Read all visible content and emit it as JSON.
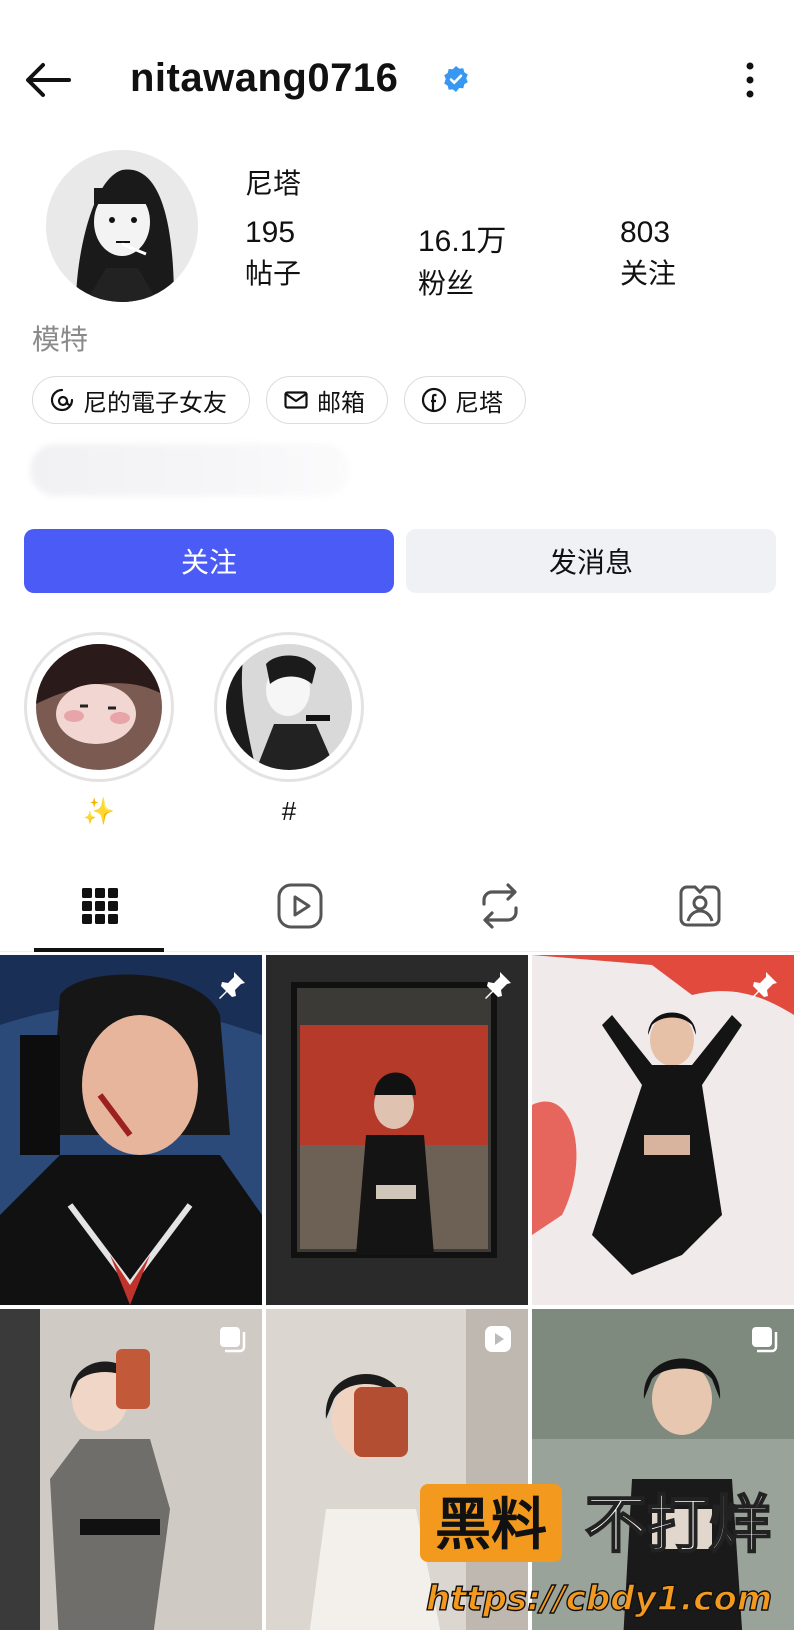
{
  "header": {
    "username": "nitawang0716",
    "verified": true
  },
  "profile": {
    "display_name": "尼塔",
    "category": "模特",
    "stats": [
      {
        "value": "195",
        "label": "帖子"
      },
      {
        "value": "16.1万",
        "label": "粉丝"
      },
      {
        "value": "803",
        "label": "关注"
      }
    ],
    "links": [
      {
        "icon": "threads-icon",
        "label": "尼的電子女友"
      },
      {
        "icon": "mail-icon",
        "label": "邮箱"
      },
      {
        "icon": "facebook-icon",
        "label": "尼塔"
      }
    ]
  },
  "actions": {
    "follow_label": "关注",
    "message_label": "发消息",
    "accent_color": "#4a5cf5"
  },
  "highlights": [
    {
      "label": "✨"
    },
    {
      "label": "#"
    }
  ],
  "tabs": [
    {
      "icon": "grid-icon",
      "active": true
    },
    {
      "icon": "reels-icon",
      "active": false
    },
    {
      "icon": "reposts-icon",
      "active": false
    },
    {
      "icon": "tagged-icon",
      "active": false
    }
  ],
  "posts": [
    {
      "badge": "pin-icon"
    },
    {
      "badge": "pin-icon"
    },
    {
      "badge": "pin-icon"
    },
    {
      "badge": "carousel-icon"
    },
    {
      "badge": "reel-icon"
    },
    {
      "badge": "carousel-icon"
    }
  ],
  "watermark": {
    "text_a": "黑料",
    "text_b": "不打烊",
    "url": "https://cbdy1.com"
  }
}
